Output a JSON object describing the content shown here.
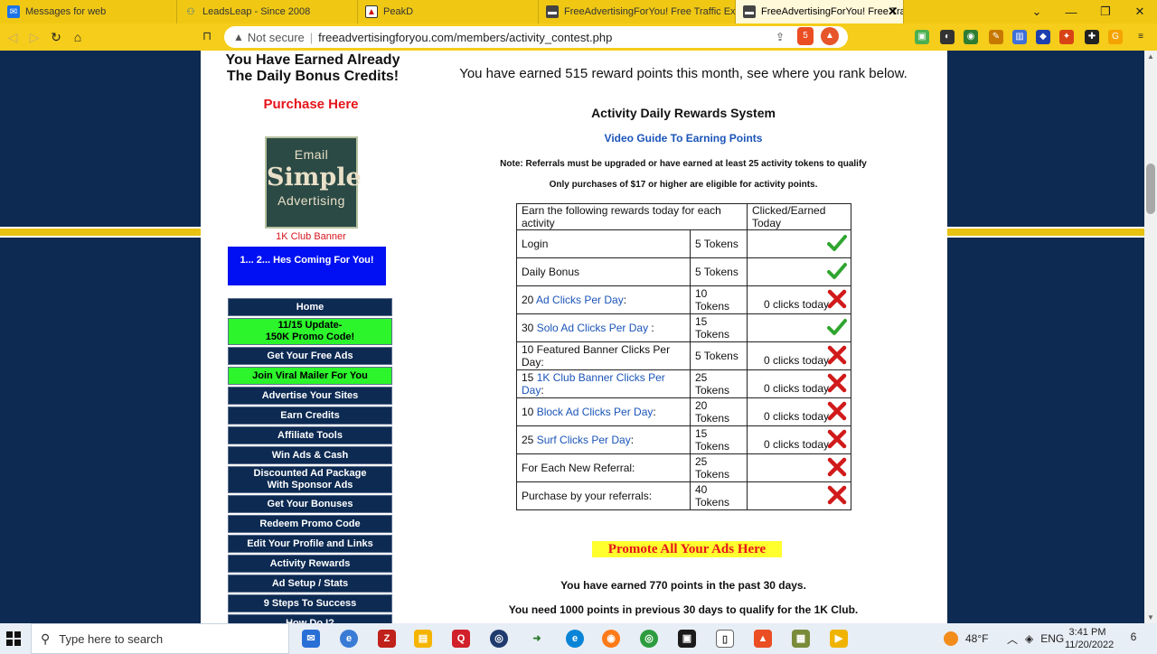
{
  "browser": {
    "tabs": [
      {
        "title": "Messages for web",
        "icon": "messages-icon",
        "active": false
      },
      {
        "title": "LeadsLeap - Since 2008",
        "icon": "leadsleap-icon",
        "active": false
      },
      {
        "title": "PeakD",
        "icon": "peakd-icon",
        "active": false
      },
      {
        "title": "FreeAdvertisingForYou! Free Traffic Ex",
        "icon": "page-icon",
        "active": false
      },
      {
        "title": "FreeAdvertisingForYou! Free Traff",
        "icon": "page-icon",
        "active": true
      }
    ],
    "url_security": "Not secure",
    "url": "freeadvertisingforyou.com/members/activity_contest.php",
    "brave_badge": "5"
  },
  "left": {
    "heading_line1": "You Have Earned Already",
    "heading_line2": "The Daily Bonus Credits!",
    "purchase_link": "Purchase Here",
    "banner": {
      "line1": "Email",
      "line2": "Simple",
      "line3": "Advertising"
    },
    "banner_caption": "1K Club Banner",
    "blue_box": "1... 2... Hes Coming For You!",
    "menu": [
      {
        "label": "Home",
        "style": "normal"
      },
      {
        "label": "11/15 Update-\n150K Promo Code!",
        "style": "green-two"
      },
      {
        "label": "Get Your Free Ads",
        "style": "normal"
      },
      {
        "label": "Join Viral Mailer For You",
        "style": "green"
      },
      {
        "label": "Advertise Your Sites",
        "style": "normal"
      },
      {
        "label": "Earn Credits",
        "style": "normal"
      },
      {
        "label": "Affiliate Tools",
        "style": "normal"
      },
      {
        "label": "Win Ads & Cash",
        "style": "normal"
      },
      {
        "label": "Discounted Ad Package\nWith Sponsor Ads",
        "style": "two"
      },
      {
        "label": "Get Your Bonuses",
        "style": "normal"
      },
      {
        "label": "Redeem Promo Code",
        "style": "normal"
      },
      {
        "label": "Edit Your Profile and Links",
        "style": "normal"
      },
      {
        "label": "Activity Rewards",
        "style": "normal"
      },
      {
        "label": "Ad Setup / Stats",
        "style": "normal"
      },
      {
        "label": "9 Steps To Success",
        "style": "normal"
      },
      {
        "label": "How Do I?",
        "style": "normal"
      }
    ]
  },
  "main": {
    "earned_month": "You have earned 515 reward points this month, see where you rank below.",
    "title": "Activity Daily Rewards System",
    "video_link": "Video Guide To Earning Points",
    "note_referrals": "Note: Referrals must be upgraded or have earned at least 25 activity tokens to qualify",
    "note_purchases": "Only purchases of $17 or higher are eligible for activity points.",
    "table": {
      "headers": [
        "Earn the following rewards today for each activity",
        "Clicked/Earned Today"
      ],
      "rows": [
        {
          "pre": "Login",
          "link": "",
          "post": "",
          "tokens": "5 Tokens",
          "clicks": "",
          "status": "done"
        },
        {
          "pre": "Daily Bonus",
          "link": "",
          "post": "",
          "tokens": "5 Tokens",
          "clicks": "",
          "status": "done"
        },
        {
          "pre": "20 ",
          "link": "Ad Clicks Per Day",
          "post": ":",
          "tokens": "10 Tokens",
          "clicks": "0 clicks today",
          "status": "not-done"
        },
        {
          "pre": "30 ",
          "link": "Solo Ad Clicks Per Day",
          "post": " :",
          "tokens": "15 Tokens",
          "clicks": "",
          "status": "done"
        },
        {
          "pre": "10 Featured Banner Clicks Per Day:",
          "link": "",
          "post": "",
          "tokens": "5 Tokens",
          "clicks": "0 clicks today",
          "status": "not-done"
        },
        {
          "pre": "15 ",
          "link": "1K Club Banner Clicks Per Day",
          "post": ":",
          "tokens": "25 Tokens",
          "clicks": "0 clicks today",
          "status": "not-done"
        },
        {
          "pre": "10 ",
          "link": "Block Ad Clicks Per Day",
          "post": ":",
          "tokens": "20 Tokens",
          "clicks": "0 clicks today",
          "status": "not-done"
        },
        {
          "pre": "25 ",
          "link": "Surf Clicks Per Day",
          "post": ":",
          "tokens": "15 Tokens",
          "clicks": "0 clicks today",
          "status": "not-done"
        },
        {
          "pre": "For Each New Referral:",
          "link": "",
          "post": "",
          "tokens": "25 Tokens",
          "clicks": "",
          "status": "not-done"
        },
        {
          "pre": "Purchase by your referrals:",
          "link": "",
          "post": "",
          "tokens": "40 Tokens",
          "clicks": "",
          "status": "not-done"
        }
      ]
    },
    "promote": "Promote All Your Ads Here",
    "points_past_30": "You have earned 770 points in the past 30 days.",
    "need_points": "You need 1000 points in previous 30 days to qualify for the 1K Club."
  },
  "taskbar": {
    "search_placeholder": "Type here to search",
    "weather": "48°F",
    "language": "ENG",
    "time": "3:41 PM",
    "date": "11/20/2022",
    "notifications": "6"
  },
  "colors": {
    "chrome_yellow": "#f0c814",
    "page_navy": "#0d2a52",
    "menu_green": "#2cf52c",
    "link_blue": "#1b55b8",
    "alert_red": "#e6141b"
  }
}
